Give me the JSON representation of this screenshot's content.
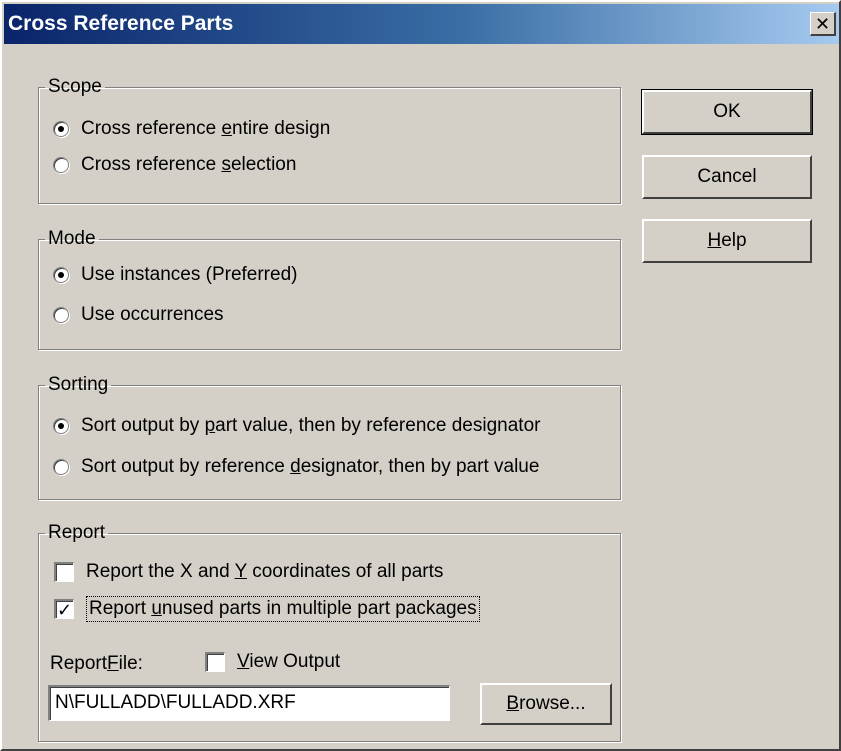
{
  "window": {
    "title": "Cross Reference Parts",
    "close_glyph": "✕"
  },
  "scope": {
    "legend": "Scope",
    "options": [
      {
        "pre": "Cross reference ",
        "key": "e",
        "post": "ntire design",
        "checked": true
      },
      {
        "pre": "Cross reference ",
        "key": "s",
        "post": "election",
        "checked": false
      }
    ]
  },
  "mode": {
    "legend": "Mode",
    "options": [
      {
        "label": "Use instances (Preferred)",
        "checked": true
      },
      {
        "label": "Use occurrences",
        "checked": false
      }
    ]
  },
  "sorting": {
    "legend": "Sorting",
    "options": [
      {
        "pre": "Sort output by ",
        "key": "p",
        "post": "art value, then by reference designator",
        "checked": true
      },
      {
        "pre": "Sort output by reference ",
        "key": "d",
        "post": "esignator, then by part value",
        "checked": false
      }
    ]
  },
  "report": {
    "legend": "Report",
    "xy_coords": {
      "pre": "Report the X and ",
      "key": "Y",
      "post": " coordinates of all parts",
      "checked": false
    },
    "unused_parts": {
      "pre": "Report ",
      "key": "u",
      "post": "nused parts in multiple part packages",
      "checked": true
    },
    "file_label": {
      "pre": "Report ",
      "key": "F",
      "post": "ile:"
    },
    "view_output": {
      "pre": "",
      "key": "V",
      "post": "iew Output",
      "checked": false
    },
    "file_value": "N\\FULLADD\\FULLADD.XRF",
    "browse": {
      "pre": "",
      "key": "B",
      "post": "rowse..."
    }
  },
  "buttons": {
    "ok": "OK",
    "cancel": "Cancel",
    "help": {
      "pre": "",
      "key": "H",
      "post": "elp"
    }
  },
  "icons": {
    "check_mark": "✓"
  }
}
